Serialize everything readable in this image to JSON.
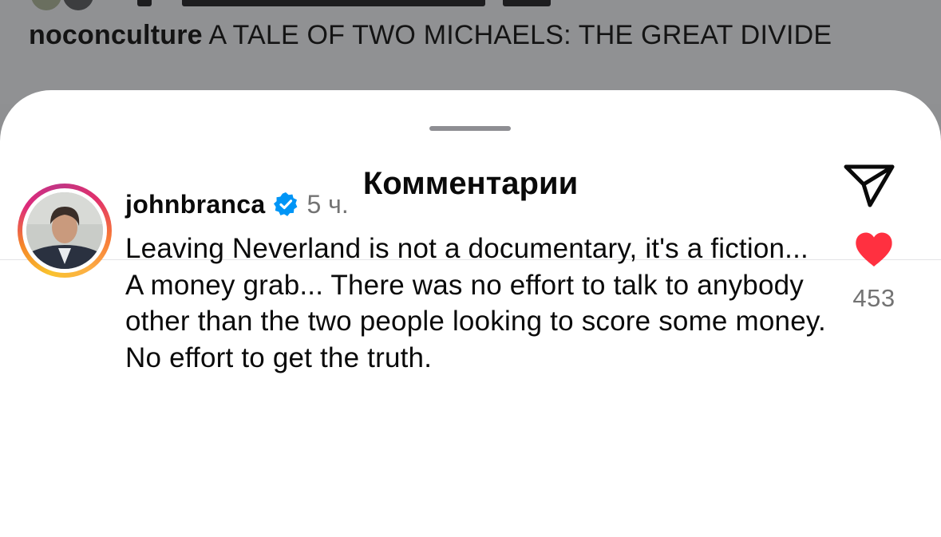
{
  "background_post": {
    "username": "noconculture",
    "caption": " A TALE OF TWO MICHAELS: THE GREAT DIVIDE"
  },
  "sheet": {
    "title": "Комментарии",
    "share_icon": "send-icon"
  },
  "comment": {
    "username": "johnbranca",
    "verified_icon": "verified-badge-icon",
    "time": "5 ч.",
    "text": "Leaving Neverland is not a documentary, it's a fiction... A money grab... There was no effort to talk to anybody other than the two people looking to score some money. No effort to get the truth.",
    "like_icon": "heart-filled-icon",
    "likes": "453"
  },
  "colors": {
    "overlay": "#909193",
    "like": "#ff3040",
    "verified": "#0095f6",
    "secondary_text": "#737373"
  }
}
